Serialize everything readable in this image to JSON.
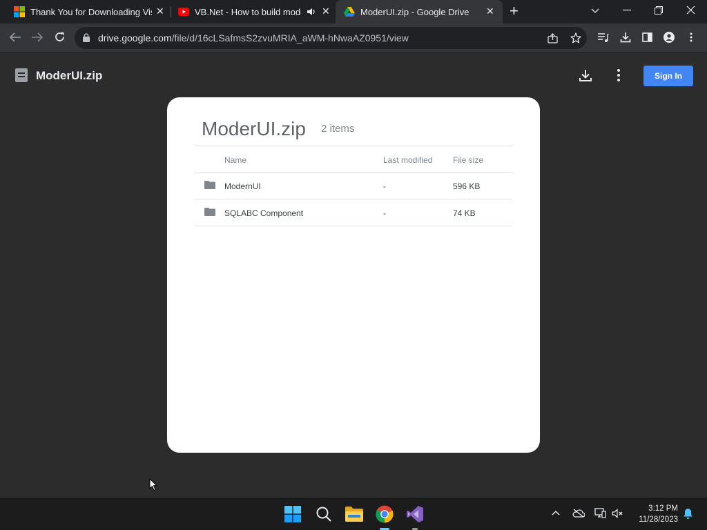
{
  "browser": {
    "tabs": [
      {
        "title": "Thank You for Downloading Visu",
        "favicon": "microsoft-logo-icon",
        "close": "✕"
      },
      {
        "title": "VB.Net - How to build mode",
        "favicon": "youtube-icon",
        "audio": "speaker-icon",
        "close": "✕"
      },
      {
        "title": "ModerUI.zip - Google Drive",
        "favicon": "google-drive-icon",
        "close": "✕"
      }
    ],
    "new_tab": "+",
    "url_host": "drive.google.com",
    "url_path": "/file/d/16cLSafmsS2zvuMRIA_aWM-hNwaAZ0951/view"
  },
  "drive": {
    "file_title": "ModerUI.zip",
    "signin_label": "Sign In"
  },
  "archive": {
    "title": "ModerUI.zip",
    "count": "2 items",
    "columns": {
      "name": "Name",
      "modified": "Last modified",
      "size": "File size"
    },
    "rows": [
      {
        "name": "ModernUI",
        "modified": "-",
        "size": "596 KB"
      },
      {
        "name": "SQLABC Component",
        "modified": "-",
        "size": "74 KB"
      }
    ]
  },
  "taskbar": {
    "time": "3:12 PM",
    "date": "11/28/2023"
  },
  "colors": {
    "accent": "#4285f4",
    "page_bg": "#2c2c2c",
    "card_bg": "#ffffff"
  }
}
